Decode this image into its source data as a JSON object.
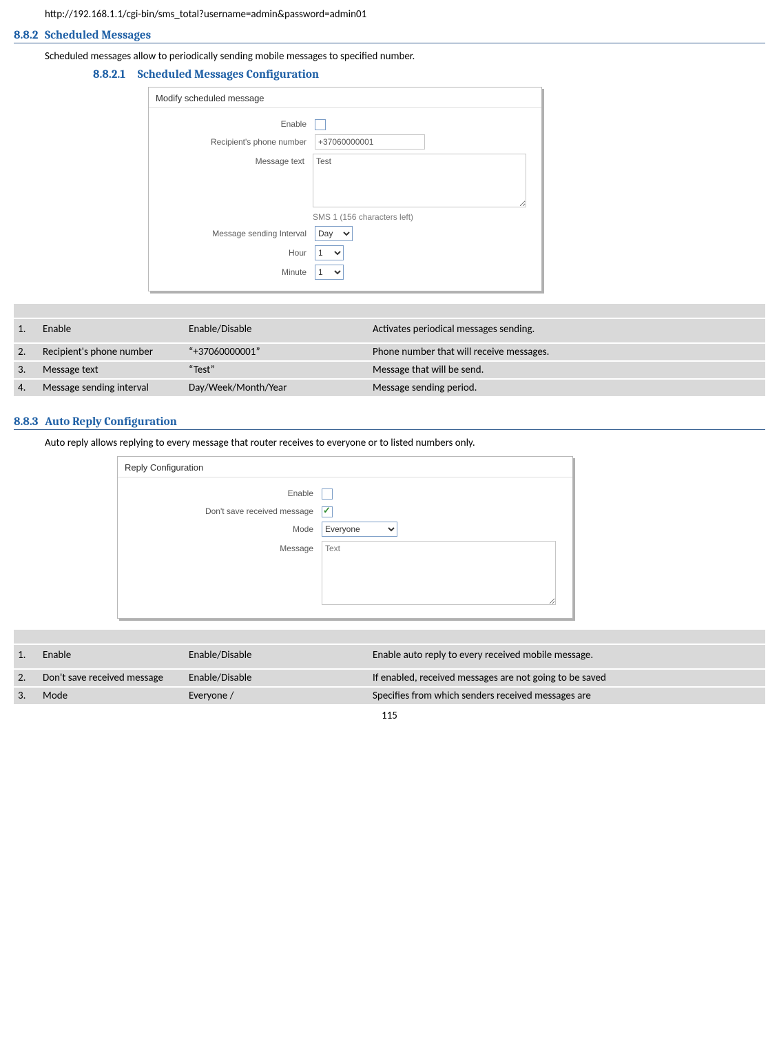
{
  "url_line": "http://192.168.1.1/cgi-bin/sms_total?username=admin&password=admin01",
  "sec_882": {
    "num": "8.8.2",
    "title": "Scheduled Messages"
  },
  "sec_882_text": "Scheduled messages allow to periodically sending mobile messages to specified number.",
  "sec_8821": {
    "num": "8.8.2.1",
    "title": "Scheduled Messages Configuration"
  },
  "fig1": {
    "title": "Modify scheduled message",
    "enable_label": "Enable",
    "recipient_label": "Recipient's phone number",
    "recipient_value": "+37060000001",
    "msg_label": "Message text",
    "msg_value": "Test",
    "hint": "SMS 1 (156 characters left)",
    "interval_label": "Message sending Interval",
    "interval_value": "Day",
    "hour_label": "Hour",
    "hour_value": "1",
    "minute_label": "Minute",
    "minute_value": "1"
  },
  "table1": {
    "rows": [
      {
        "n": "1.",
        "name": "Enable",
        "val": "Enable/Disable",
        "desc": "Activates periodical messages sending."
      },
      {
        "n": "2.",
        "name": "Recipient's phone number",
        "val": "“+37060000001”",
        "desc": "Phone number that will receive messages."
      },
      {
        "n": "3.",
        "name": "Message text",
        "val": "“Test”",
        "desc": "Message that will be send."
      },
      {
        "n": "4.",
        "name": "Message sending interval",
        "val": "Day/Week/Month/Year",
        "desc": "Message sending period."
      }
    ]
  },
  "sec_883": {
    "num": "8.8.3",
    "title": "Auto Reply Configuration"
  },
  "sec_883_text": "Auto reply allows replying to every message that router receives to everyone or to listed numbers only.",
  "fig2": {
    "title": "Reply Configuration",
    "enable_label": "Enable",
    "dontsave_label": "Don't save received message",
    "mode_label": "Mode",
    "mode_value": "Everyone",
    "message_label": "Message",
    "message_placeholder": "Text"
  },
  "table2": {
    "rows": [
      {
        "n": "1.",
        "name": "Enable",
        "val": "Enable/Disable",
        "desc": "Enable auto reply to every received mobile message."
      },
      {
        "n": "2.",
        "name": "Don't save received message",
        "val": "Enable/Disable",
        "desc": "If enabled, received messages are not going to be saved"
      },
      {
        "n": "3.",
        "name": "Mode",
        "val": "Everyone /",
        "desc": "Specifies from which senders received messages are"
      }
    ]
  },
  "page_number": "115"
}
